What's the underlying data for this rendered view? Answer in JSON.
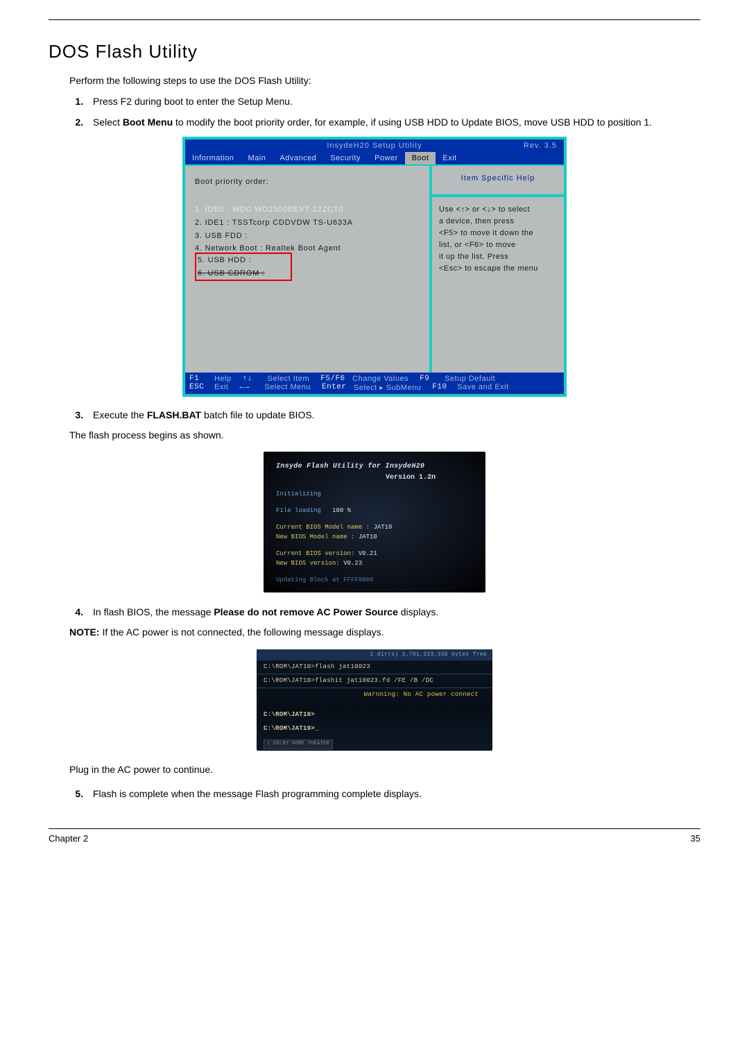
{
  "page": {
    "title": "DOS Flash Utility",
    "intro": "Perform the following steps to use the DOS Flash Utility:",
    "chapter": "Chapter 2",
    "page_number": "35"
  },
  "steps": {
    "s1": "Press F2 during boot to enter the Setup Menu.",
    "s2_a": "Select ",
    "s2_b": "Boot Menu",
    "s2_c": " to modify the boot priority order, for example, if using USB HDD to Update BIOS, move USB HDD to position 1.",
    "s3_a": "Execute the ",
    "s3_b": "FLASH.BAT",
    "s3_c": " batch file to update BIOS.",
    "s3_follow": "The flash process begins as shown.",
    "s4_a": "In flash BIOS, the message ",
    "s4_b": "Please do not remove AC Power Source",
    "s4_c": " displays.",
    "s4_note_a": "NOTE:",
    "s4_note_b": " If the AC power is not connected, the following message displays.",
    "s4_follow": "Plug in the AC power to continue.",
    "s5": "Flash is complete when the message Flash programming complete displays."
  },
  "bios": {
    "title": "InsydeH20 Setup Utility",
    "rev": "Rev. 3.5",
    "tabs": [
      "Information",
      "Main",
      "Advanced",
      "Security",
      "Power",
      "Boot",
      "Exit"
    ],
    "heading": "Boot priority order:",
    "items": [
      "1. IDE0 : WDC WD2500BEVT-22ZCT0",
      "2. IDE1 : TSSTcorp CDDVDW TS-U633A",
      "3. USB FDD :",
      "4. Network Boot : Realtek Boot Agent",
      "5. USB HDD :",
      "6. USB CDROM :"
    ],
    "help_title": "Item Specific Help",
    "help_body_1": "Use <↑> or <↓> to select",
    "help_body_2": "a device, then press",
    "help_body_3": "<F5> to move it down the",
    "help_body_4": "list, or <F6> to move",
    "help_body_5": "it up the list. Press",
    "help_body_6": "<Esc> to escape the menu",
    "footer": {
      "f1k": "F1",
      "f1v": "Help",
      "ud": "↑↓",
      "udv": "Select  Item",
      "f56": "F5/F6",
      "f56v": "Change  Values",
      "f9": "F9",
      "f9v": "Setup  Default",
      "esc": "ESC",
      "escv": "Exit",
      "lr": "←→",
      "lrv": "Select  Menu",
      "ent": "Enter",
      "entv": "Select  ▸  SubMenu",
      "f10": "F10",
      "f10v": "Save  and  Exit"
    }
  },
  "shot2": {
    "title": "Insyde Flash Utility for InsydeH20",
    "version": "Version 1.2n",
    "init": "Initializing",
    "file": "File loading",
    "pct": "100 %",
    "curr_model_l": "Current BIOS Model name :",
    "curr_model_v": "JAT10",
    "new_model_l": "New     BIOS Model name :",
    "new_model_v": "JAT10",
    "curr_ver_l": "Current BIOS version:",
    "curr_ver_v": "V0.21",
    "new_ver_l": "New     BIOS version:",
    "new_ver_v": "V0.23",
    "updating": "Updating Block at FFFF0000"
  },
  "shot3": {
    "topbar": "2 dir(s)   2,701,333,336 bytes free",
    "l1": "C:\\ROM\\JAT10>flash jat10023",
    "l2": "C:\\ROM\\JAT10>flashit jat10023.fd /FE /B /DC",
    "warn": "Warnning: No AC power connect",
    "l3": "C:\\ROM\\JAT10>",
    "l4": "C:\\ROM\\JAT10>_",
    "badge": "▯ DOLBY HOME THEATER"
  }
}
